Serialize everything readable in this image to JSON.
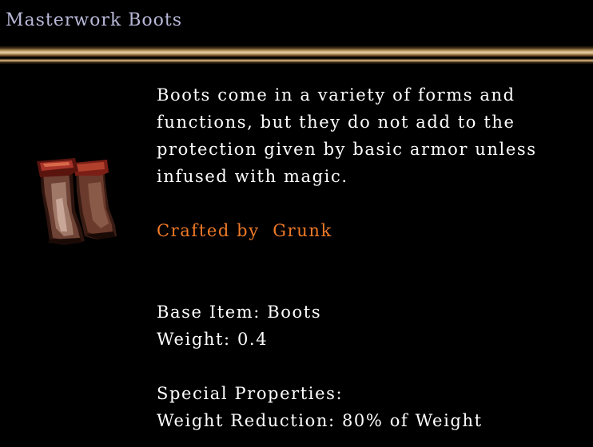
{
  "item": {
    "name": "Masterwork Boots",
    "description_lines": [
      "Boots come in a variety of forms and",
      "functions, but they do not add to the",
      "protection given by basic armor unless",
      "infused with magic."
    ],
    "crafted_by_label": "Crafted by",
    "crafter": "Grunk",
    "base_item_line": "Base Item: Boots",
    "weight_line": "Weight: 0.4",
    "special_header": "Special Properties:",
    "special_lines": [
      "Weight Reduction: 80% of Weight"
    ],
    "icon": "boots-icon"
  },
  "colors": {
    "title": "#b8b8d8",
    "body_text": "#ffffff",
    "crafted_text": "#f07a28",
    "background": "#000000",
    "divider_gold": "#c9a978"
  }
}
